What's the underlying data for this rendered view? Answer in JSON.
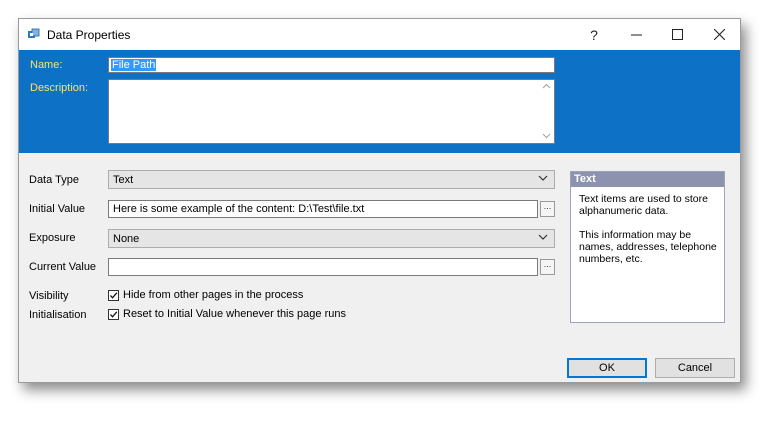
{
  "window": {
    "title": "Data Properties",
    "help_label": "?",
    "minimize_label": "—",
    "close_label": "✕"
  },
  "banner": {
    "name_label": "Name:",
    "name_value": "File Path",
    "description_label": "Description:",
    "description_value": ""
  },
  "form": {
    "data_type_label": "Data Type",
    "data_type_value": "Text",
    "initial_value_label": "Initial Value",
    "initial_value": "Here is some example of the content: D:\\Test\\file.txt",
    "exposure_label": "Exposure",
    "exposure_value": "None",
    "current_value_label": "Current Value",
    "current_value": "",
    "browse_label": "...",
    "visibility_label": "Visibility",
    "visibility_checkbox_label": "Hide from other pages in the process",
    "visibility_checked": true,
    "initialisation_label": "Initialisation",
    "initialisation_checkbox_label": "Reset to Initial Value whenever this page runs",
    "initialisation_checked": true
  },
  "info": {
    "heading": "Text",
    "para1": "Text items are used to store alphanumeric data.",
    "para2": "This information may be names, addresses, telephone numbers, etc."
  },
  "buttons": {
    "ok_label": "OK",
    "cancel_label": "Cancel"
  },
  "colors": {
    "banner": "#0d72c6",
    "banner_label": "#f6e46a",
    "info_header": "#8d93ae",
    "default_button_border": "#0078d7"
  },
  "icons": {
    "app": "data-item-icon",
    "dropdown": "chevron-down-icon",
    "check": "checkmark-icon"
  }
}
